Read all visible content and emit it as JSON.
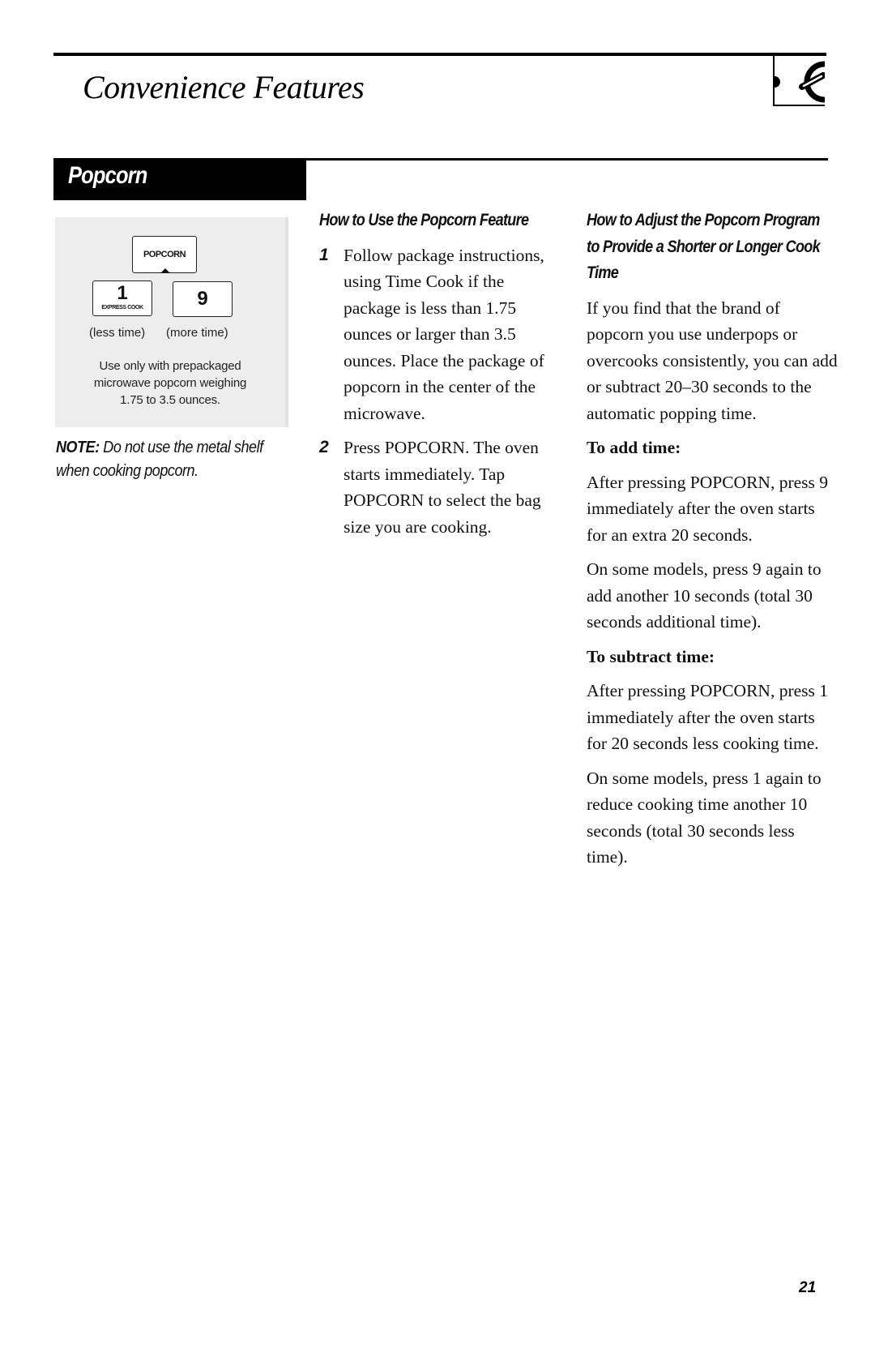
{
  "header": {
    "title": "Convenience Features",
    "icon": "dial-knob-icon"
  },
  "section": {
    "title": "Popcorn"
  },
  "keypad_panel": {
    "popcorn_key": "POPCORN",
    "key_1_digit": "1",
    "key_1_sub": "EXPRESS COOK",
    "key_9_digit": "9",
    "caption_less": "(less time)",
    "caption_more": "(more time)",
    "note_lines": [
      "Use only with prepackaged",
      "microwave popcorn weighing",
      "1.75 to 3.5 ounces."
    ]
  },
  "side_note": {
    "label": "NOTE:",
    "text": " Do not use the metal shelf when cooking popcorn."
  },
  "how_to_use": {
    "heading": "How to Use the Popcorn Feature",
    "steps": [
      {
        "number": "1",
        "text": "Follow package instructions, using Time Cook if the package is less than 1.75 ounces or larger than 3.5 ounces. Place the package of popcorn in the center of the microwave."
      },
      {
        "number": "2",
        "text": "Press POPCORN. The oven starts immediately. Tap POPCORN to select the bag size you are cooking."
      }
    ]
  },
  "how_to_adjust": {
    "heading": "How to Adjust the Popcorn Program to Provide a Shorter or Longer Cook Time",
    "intro": "If you find that the brand of popcorn you use underpops or overcooks consistently, you can add or subtract 20–30 seconds to the automatic popping time.",
    "add_heading": "To add time:",
    "add_paras": [
      "After pressing POPCORN, press 9 immediately after the oven starts for an extra 20 seconds.",
      "On some models, press 9 again to add another 10 seconds (total 30 seconds additional time)."
    ],
    "subtract_heading": "To subtract time:",
    "subtract_paras": [
      "After pressing POPCORN, press 1 immediately after the oven starts for 20 seconds less cooking time.",
      "On some models, press 1 again to reduce cooking time another 10 seconds (total 30 seconds less time)."
    ]
  },
  "footer": {
    "page_number": "21"
  }
}
